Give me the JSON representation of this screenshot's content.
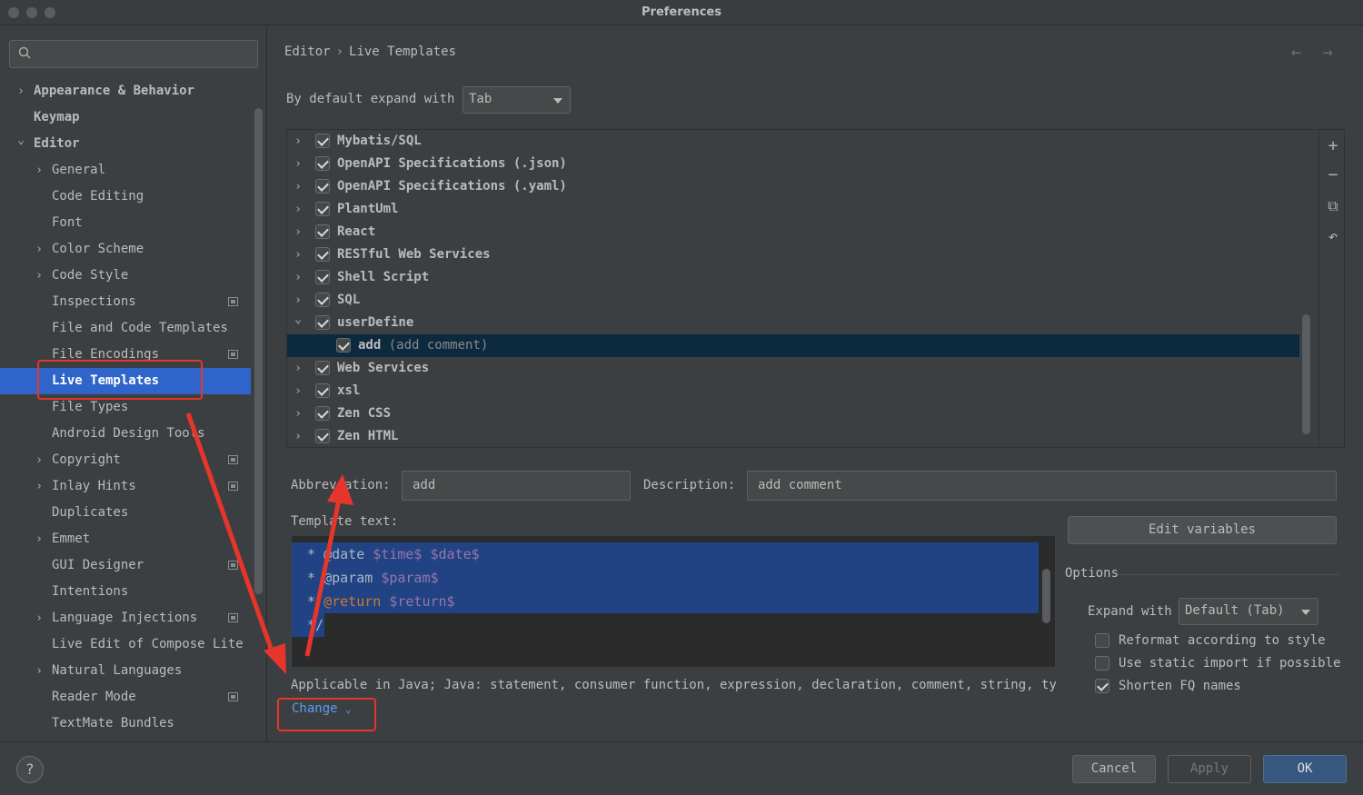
{
  "window": {
    "title": "Preferences"
  },
  "search": {
    "placeholder": ""
  },
  "sidebar": {
    "items": [
      {
        "label": "Appearance & Behavior",
        "chevron": "›"
      },
      {
        "label": "Keymap",
        "chevron": ""
      },
      {
        "label": "Editor",
        "chevron": "⌄"
      },
      {
        "label": "General",
        "chevron": "›"
      },
      {
        "label": "Code Editing",
        "chevron": ""
      },
      {
        "label": "Font",
        "chevron": ""
      },
      {
        "label": "Color Scheme",
        "chevron": "›"
      },
      {
        "label": "Code Style",
        "chevron": "›"
      },
      {
        "label": "Inspections",
        "chevron": ""
      },
      {
        "label": "File and Code Templates",
        "chevron": ""
      },
      {
        "label": "File Encodings",
        "chevron": ""
      },
      {
        "label": "Live Templates",
        "chevron": ""
      },
      {
        "label": "File Types",
        "chevron": ""
      },
      {
        "label": "Android Design Tools",
        "chevron": ""
      },
      {
        "label": "Copyright",
        "chevron": "›"
      },
      {
        "label": "Inlay Hints",
        "chevron": "›"
      },
      {
        "label": "Duplicates",
        "chevron": ""
      },
      {
        "label": "Emmet",
        "chevron": "›"
      },
      {
        "label": "GUI Designer",
        "chevron": ""
      },
      {
        "label": "Intentions",
        "chevron": ""
      },
      {
        "label": "Language Injections",
        "chevron": "›"
      },
      {
        "label": "Live Edit of Compose Lite",
        "chevron": ""
      },
      {
        "label": "Natural Languages",
        "chevron": "›"
      },
      {
        "label": "Reader Mode",
        "chevron": ""
      },
      {
        "label": "TextMate Bundles",
        "chevron": ""
      }
    ]
  },
  "breadcrumb": {
    "parent": "Editor",
    "separator": "›",
    "current": "Live Templates"
  },
  "nav": {
    "back": "←",
    "forward": "→"
  },
  "expand": {
    "label": "By default expand with",
    "value": "Tab"
  },
  "templates": {
    "rows": [
      {
        "chevron": "›",
        "name": "Mybatis/SQL",
        "desc": ""
      },
      {
        "chevron": "›",
        "name": "OpenAPI Specifications (.json)",
        "desc": ""
      },
      {
        "chevron": "›",
        "name": "OpenAPI Specifications (.yaml)",
        "desc": ""
      },
      {
        "chevron": "›",
        "name": "PlantUml",
        "desc": ""
      },
      {
        "chevron": "›",
        "name": "React",
        "desc": ""
      },
      {
        "chevron": "›",
        "name": "RESTful Web Services",
        "desc": ""
      },
      {
        "chevron": "›",
        "name": "Shell Script",
        "desc": ""
      },
      {
        "chevron": "›",
        "name": "SQL",
        "desc": ""
      },
      {
        "chevron": "⌄",
        "name": "userDefine",
        "desc": ""
      },
      {
        "chevron": "",
        "name": "add",
        "desc": "(add comment)"
      },
      {
        "chevron": "›",
        "name": "Web Services",
        "desc": ""
      },
      {
        "chevron": "›",
        "name": "xsl",
        "desc": ""
      },
      {
        "chevron": "›",
        "name": "Zen CSS",
        "desc": ""
      },
      {
        "chevron": "›",
        "name": "Zen HTML",
        "desc": ""
      }
    ],
    "toolbar": {
      "add": "+",
      "remove": "−",
      "copy": "⧉",
      "restore": "↶"
    }
  },
  "abbreviation": {
    "label": "Abbreviation:",
    "value": "add"
  },
  "description": {
    "label": "Description:",
    "value": "add comment"
  },
  "template_text": {
    "label": "Template text:",
    "lines": [
      {
        "prefix": " * @date ",
        "tokens": "$time$ $date$"
      },
      {
        "prefix": " * @param ",
        "tokens": "$param$"
      },
      {
        "prefix": " * ",
        "kw": "@return",
        "tokens": " $return$"
      },
      {
        "prefix": " */",
        "tokens": ""
      }
    ]
  },
  "edit_variables": "Edit variables",
  "options": {
    "title": "Options",
    "expand_label": "Expand with",
    "expand_value": "Default (Tab)",
    "reformat": "Reformat according to style",
    "static_import": "Use static import if possible",
    "shorten": "Shorten FQ names"
  },
  "applicable": "Applicable in Java; Java: statement, consumer function, expression, declaration, comment, string, ty",
  "change": "Change",
  "footer": {
    "help": "?",
    "cancel": "Cancel",
    "apply": "Apply",
    "ok": "OK"
  },
  "colors": {
    "selection": "#2f65ca",
    "annotation": "#e6352b",
    "link": "#589df6",
    "ok": "#365880"
  }
}
